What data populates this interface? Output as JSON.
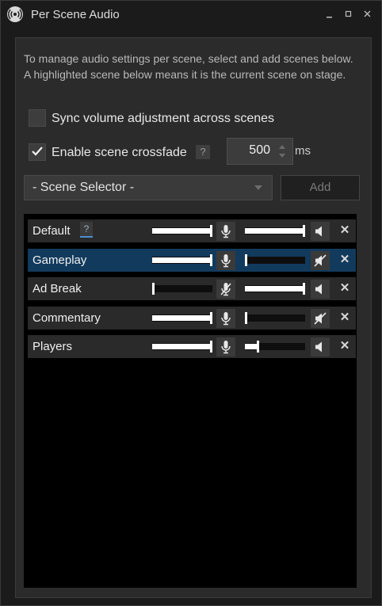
{
  "window": {
    "title": "Per Scene Audio"
  },
  "description": "To manage audio settings per scene, select and add scenes below. A highlighted scene below means it is the current scene on stage.",
  "sync": {
    "label": "Sync volume adjustment across scenes",
    "checked": false
  },
  "crossfade": {
    "label": "Enable scene crossfade",
    "checked": true,
    "help": "?",
    "value": "500",
    "unit": "ms"
  },
  "selector": {
    "value": "- Scene Selector -"
  },
  "add_label": "Add",
  "scenes": [
    {
      "name": "Default",
      "help": "?",
      "mic_level": 1.0,
      "mic_muted": false,
      "speaker_level": 1.0,
      "speaker_muted": false,
      "active": false
    },
    {
      "name": "Gameplay",
      "mic_level": 1.0,
      "mic_muted": false,
      "speaker_level": 0.0,
      "speaker_muted": true,
      "active": true
    },
    {
      "name": "Ad Break",
      "mic_level": 0.0,
      "mic_muted": true,
      "speaker_level": 1.0,
      "speaker_muted": false,
      "active": false
    },
    {
      "name": "Commentary",
      "mic_level": 1.0,
      "mic_muted": false,
      "speaker_level": 0.0,
      "speaker_muted": true,
      "active": false
    },
    {
      "name": "Players",
      "mic_level": 1.0,
      "mic_muted": false,
      "speaker_level": 0.2,
      "speaker_muted": false,
      "active": false
    }
  ],
  "remove_symbol": "✕",
  "icons": {
    "app": "broadcast-icon",
    "mic": "microphone-icon",
    "mic_muted": "microphone-muted-icon",
    "speaker": "speaker-icon",
    "speaker_muted": "speaker-muted-icon",
    "remove": "close-icon"
  },
  "colors": {
    "active_row": "#123a5c",
    "background": "#1b1b1b",
    "panel": "#2b2b2b"
  }
}
